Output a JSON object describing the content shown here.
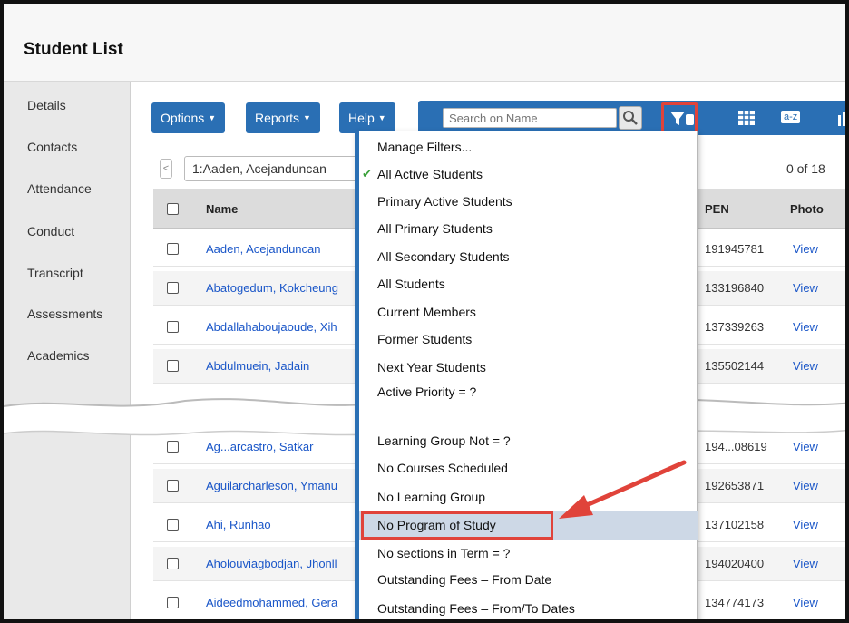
{
  "page": {
    "title": "Student List"
  },
  "sidebar": {
    "items": [
      {
        "label": "Details"
      },
      {
        "label": "Contacts"
      },
      {
        "label": "Attendance"
      },
      {
        "label": "Conduct"
      },
      {
        "label": "Transcript"
      },
      {
        "label": "Assessments"
      },
      {
        "label": "Academics"
      }
    ]
  },
  "toolbar": {
    "options_label": "Options",
    "reports_label": "Reports",
    "help_label": "Help",
    "search_placeholder": "Search on Name",
    "sort_label": "a-z"
  },
  "nav": {
    "current_record": "1:Aaden, Acejanduncan",
    "count_text": "0 of 18"
  },
  "grid": {
    "columns": {
      "name": "Name",
      "pen": "PEN",
      "photo": "Photo"
    },
    "rows": [
      {
        "name": "Aaden, Acejanduncan",
        "pen": "191945781",
        "photo": "View",
        "y": "2"
      },
      {
        "name": "Abatogedum, Kokcheung",
        "pen": "133196840",
        "photo": "View",
        "y": "2"
      },
      {
        "name": "Abdallahaboujaoude, Xih",
        "pen": "137339263",
        "photo": "View",
        "y": "2"
      },
      {
        "name": "Abdulmuein, Jadain",
        "pen": "135502144",
        "photo": "View",
        "y": "2"
      },
      {
        "name": "Ag...arcastro, Satkar",
        "pen": "194...08619",
        "photo": "View",
        "y": "2"
      },
      {
        "name": "Aguilarcharleson, Ymanu",
        "pen": "192653871",
        "photo": "View",
        "y": "2"
      },
      {
        "name": "Ahi, Runhao",
        "pen": "137102158",
        "photo": "View",
        "y": "2"
      },
      {
        "name": "Aholouviagbodjan, Jhonll",
        "pen": "194020400",
        "photo": "View",
        "y": "2"
      },
      {
        "name": "Aideedmohammed, Gera",
        "pen": "134774173",
        "photo": "View",
        "y": "2"
      }
    ]
  },
  "filter_menu": {
    "items": [
      {
        "label": "Manage Filters..."
      },
      {
        "label": "All Active Students",
        "checked": true
      },
      {
        "label": "Primary Active Students"
      },
      {
        "label": "All Primary Students"
      },
      {
        "label": "All Secondary Students"
      },
      {
        "label": "All Students"
      },
      {
        "label": "Current Members"
      },
      {
        "label": "Former Students"
      },
      {
        "label": "Next Year Students"
      },
      {
        "label": "Active Priority = ?"
      },
      {
        "label": "Learning Group Not = ?"
      },
      {
        "label": "No Courses Scheduled"
      },
      {
        "label": "No Learning Group"
      },
      {
        "label": "No Program of Study",
        "highlighted": true
      },
      {
        "label": "No sections in Term = ?"
      },
      {
        "label": "Outstanding Fees – From Date"
      },
      {
        "label": "Outstanding Fees – From/To Dates"
      }
    ]
  },
  "colors": {
    "toolbar_blue": "#2a6fb4",
    "annotation_red": "#e0433a",
    "link_blue": "#1a56c8",
    "highlight": "#cdd8e6"
  },
  "icons": [
    "search-icon",
    "filter-icon",
    "grid-view-icon",
    "sort-az-icon",
    "chart-icon",
    "chevron-left-icon",
    "checkmark-icon"
  ]
}
